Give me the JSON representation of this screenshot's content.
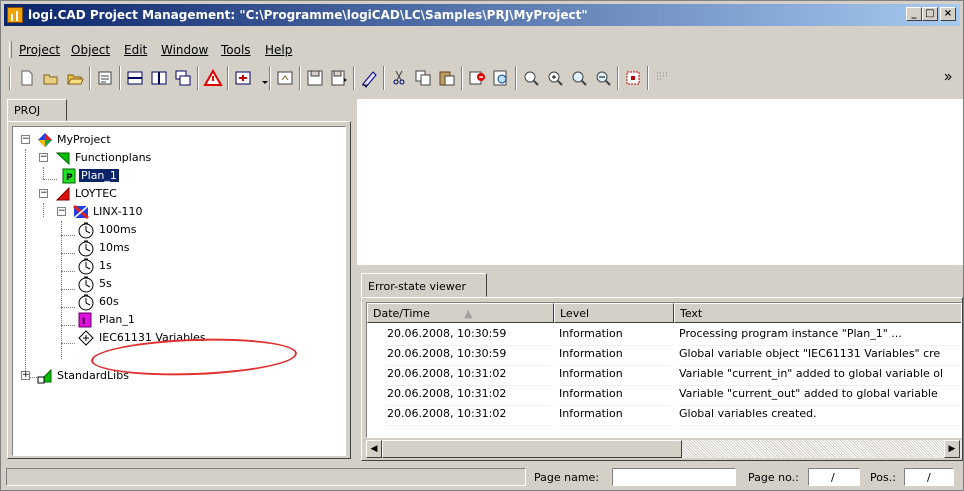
{
  "window": {
    "title": "logi.CAD Project Management: \"C:\\Programme\\logiCAD\\LC\\Samples\\PRJ\\MyProject\"",
    "controls": [
      "minimize",
      "maximize",
      "close"
    ]
  },
  "menu": {
    "items": [
      {
        "label": "Project"
      },
      {
        "label": "Object"
      },
      {
        "label": "Edit"
      },
      {
        "label": "Window"
      },
      {
        "label": "Tools"
      },
      {
        "label": "Help"
      }
    ]
  },
  "toolbar": {
    "buttons": [
      "new-icon",
      "open-icon",
      "open-folder-icon",
      "properties-icon",
      "split-horizontal-icon",
      "split-vertical-icon",
      "cascade-icon",
      "warning-icon",
      "insert-icon",
      "up-folder-icon",
      "save-icon",
      "save-as-icon",
      "compile-icon",
      "cut-icon",
      "copy-icon",
      "paste-icon",
      "delete-icon",
      "find-icon",
      "zoom-icon",
      "zoom-plus-icon",
      "search-next-icon",
      "search-prev-icon",
      "select-icon",
      "grid-icon",
      "more-icon"
    ]
  },
  "tree": {
    "tab_label": "PROJ",
    "nodes": [
      {
        "label": "MyProject",
        "icon": "project-icon"
      },
      {
        "label": "Functionplans",
        "icon": "functionplans-icon"
      },
      {
        "label": "Plan_1",
        "icon": "plan-icon",
        "selected": true
      },
      {
        "label": "LOYTEC",
        "icon": "loytec-icon"
      },
      {
        "label": "LINX-110",
        "icon": "device-icon"
      },
      {
        "label": "100ms",
        "icon": "timer-icon"
      },
      {
        "label": "10ms",
        "icon": "timer-icon"
      },
      {
        "label": "1s",
        "icon": "timer-icon"
      },
      {
        "label": "5s",
        "icon": "timer-icon"
      },
      {
        "label": "60s",
        "icon": "timer-icon"
      },
      {
        "label": "Plan_1",
        "icon": "program-instance-icon"
      },
      {
        "label": "IEC61131 Variables",
        "icon": "variables-icon"
      },
      {
        "label": "StandardLibs",
        "icon": "library-icon"
      }
    ]
  },
  "error_viewer": {
    "tab_label": "Error-state viewer",
    "columns": [
      "Date/Time",
      "Level",
      "Text"
    ],
    "rows": [
      {
        "date": "20.06.2008, 10:30:59",
        "level": "Information",
        "text": "Processing program instance \"Plan_1\" ..."
      },
      {
        "date": "20.06.2008, 10:30:59",
        "level": "Information",
        "text": "Global variable object \"IEC61131 Variables\" cre"
      },
      {
        "date": "20.06.2008, 10:31:02",
        "level": "Information",
        "text": "Variable \"current_in\" added to global variable ol"
      },
      {
        "date": "20.06.2008, 10:31:02",
        "level": "Information",
        "text": "Variable \"current_out\" added to global variable"
      },
      {
        "date": "20.06.2008, 10:31:02",
        "level": "Information",
        "text": "Global variables created."
      }
    ]
  },
  "statusbar": {
    "page_name_label": "Page name:",
    "page_name_value": "",
    "page_no_label": "Page no.:",
    "page_no_value": "/",
    "pos_label": "Pos.:",
    "pos_value": "/"
  },
  "colors": {
    "title_start": "#0a246a",
    "title_end": "#a6caf0",
    "selection": "#0a246a",
    "annotation": "#e03030",
    "chrome": "#d4d0c8"
  }
}
